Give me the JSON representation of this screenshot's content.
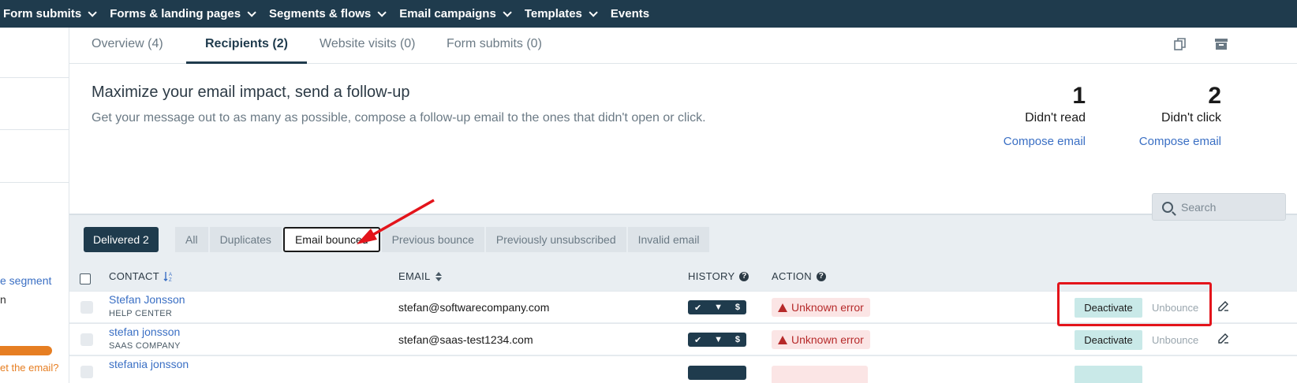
{
  "topnav": {
    "items": [
      {
        "label": "Form submits",
        "dropdown": true
      },
      {
        "label": "Forms & landing pages",
        "dropdown": true
      },
      {
        "label": "Segments & flows",
        "dropdown": true
      },
      {
        "label": "Email campaigns",
        "dropdown": true
      },
      {
        "label": "Templates",
        "dropdown": true
      },
      {
        "label": "Events",
        "dropdown": false
      }
    ]
  },
  "left_panel": {
    "segment_link": "e segment",
    "fragment_text": "n",
    "email_link": "et the email?"
  },
  "tabs": [
    {
      "label": "Overview (4)",
      "active": false
    },
    {
      "label": "Recipients (2)",
      "active": true
    },
    {
      "label": "Website visits (0)",
      "active": false
    },
    {
      "label": "Form submits (0)",
      "active": false
    }
  ],
  "tab_icons": [
    "copy-icon",
    "archive-icon"
  ],
  "followup": {
    "title": "Maximize your email impact, send a follow-up",
    "subtitle": "Get your message out to as many as possible, compose a follow-up email to the ones that didn't open or click.",
    "stats": [
      {
        "number": "1",
        "label": "Didn't read",
        "link": "Compose email"
      },
      {
        "number": "2",
        "label": "Didn't click",
        "link": "Compose email"
      }
    ]
  },
  "search": {
    "placeholder": "Search"
  },
  "filters": {
    "delivered": "Delivered 2",
    "items": [
      "All",
      "Duplicates",
      "Email bounced",
      "Previous bounce",
      "Previously unsubscribed",
      "Invalid email"
    ]
  },
  "table": {
    "headers": {
      "contact": "CONTACT",
      "email": "EMAIL",
      "history": "HISTORY",
      "action": "ACTION"
    },
    "rows": [
      {
        "name": "Stefan Jonsson",
        "company": "HELP CENTER",
        "email": "stefan@softwarecompany.com",
        "action": "Unknown error",
        "deactivate": "Deactivate",
        "unbounce": "Unbounce"
      },
      {
        "name": "stefan jonsson",
        "company": "SAAS COMPANY",
        "email": "stefan@saas-test1234.com",
        "action": "Unknown error",
        "deactivate": "Deactivate",
        "unbounce": "Unbounce"
      },
      {
        "name": "stefania jonsson",
        "company": "",
        "email": "",
        "action": "",
        "deactivate": "",
        "unbounce": ""
      }
    ],
    "history_icons": [
      "check-icon",
      "filter-icon",
      "dollar-icon"
    ]
  },
  "colors": {
    "nav_bg": "#1f3b4d",
    "link": "#3a6fc4",
    "error": "#b62a2a",
    "annotation": "#e3141b",
    "accent_orange": "#e67e22"
  }
}
